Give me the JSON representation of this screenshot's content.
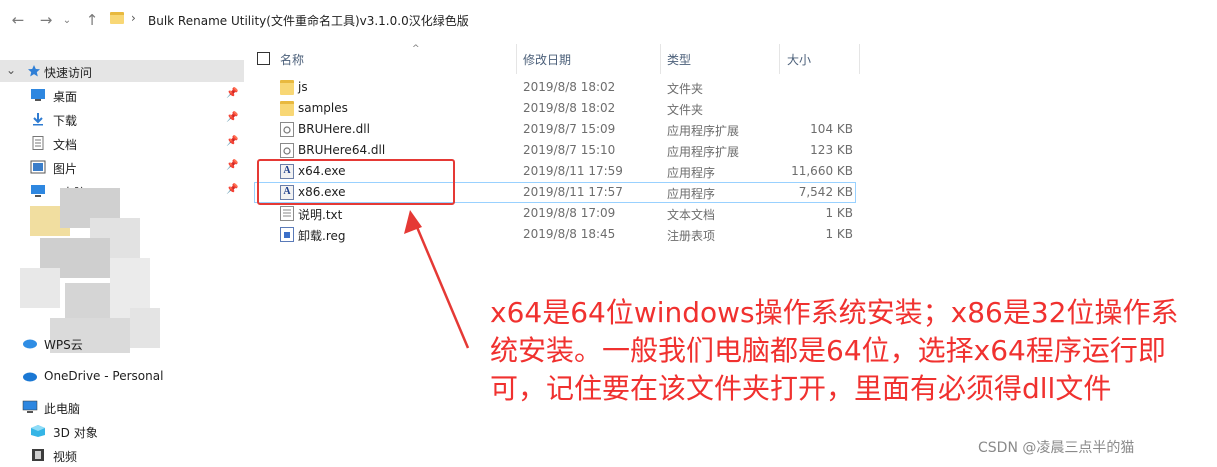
{
  "address_bar": {
    "back_icon": "←",
    "forward_icon": "→",
    "recent_icon": "⌄",
    "up_icon": "↑",
    "separator": "›",
    "path": "Bulk Rename Utility(文件重命名工具)v3.1.0.0汉化绿色版"
  },
  "sidebar": {
    "quick_access": "快速访问",
    "pinned": [
      {
        "label": "桌面",
        "pin": "📌"
      },
      {
        "label": "下载",
        "pin": "📌"
      },
      {
        "label": "文档",
        "pin": "📌"
      },
      {
        "label": "图片",
        "pin": "📌"
      },
      {
        "label": "电脑",
        "pin": "📌"
      }
    ],
    "wps": "WPS云",
    "onedrive": "OneDrive - Personal",
    "this_pc": "此电脑",
    "objects_3d": "3D 对象",
    "videos": "视频"
  },
  "columns": {
    "name": "名称",
    "date": "修改日期",
    "type": "类型",
    "size": "大小",
    "sort_icon": "^"
  },
  "files": [
    {
      "name": "js",
      "date": "2019/8/8 18:02",
      "type": "文件夹",
      "size": "",
      "icon": "folder-icon"
    },
    {
      "name": "samples",
      "date": "2019/8/8 18:02",
      "type": "文件夹",
      "size": "",
      "icon": "folder-icon"
    },
    {
      "name": "BRUHere.dll",
      "date": "2019/8/7 15:09",
      "type": "应用程序扩展",
      "size": "104 KB",
      "icon": "dll-icon"
    },
    {
      "name": "BRUHere64.dll",
      "date": "2019/8/7 15:10",
      "type": "应用程序扩展",
      "size": "123 KB",
      "icon": "dll-icon"
    },
    {
      "name": "x64.exe",
      "date": "2019/8/11 17:59",
      "type": "应用程序",
      "size": "11,660 KB",
      "icon": "exe-icon"
    },
    {
      "name": "x86.exe",
      "date": "2019/8/11 17:57",
      "type": "应用程序",
      "size": "7,542 KB",
      "icon": "exe-icon"
    },
    {
      "name": "说明.txt",
      "date": "2019/8/8 17:09",
      "type": "文本文档",
      "size": "1 KB",
      "icon": "txt-icon"
    },
    {
      "name": "卸载.reg",
      "date": "2019/8/8 18:45",
      "type": "注册表项",
      "size": "1 KB",
      "icon": "reg-icon"
    }
  ],
  "annotation": {
    "text": "x64是64位windows操作系统安装；x86是32位操作系统安装。一般我们电脑都是64位，选择x64程序运行即可，记住要在该文件夹打开，里面有必须得dll文件",
    "color": "#f0312f"
  },
  "watermark": "CSDN @凌晨三点半的猫"
}
